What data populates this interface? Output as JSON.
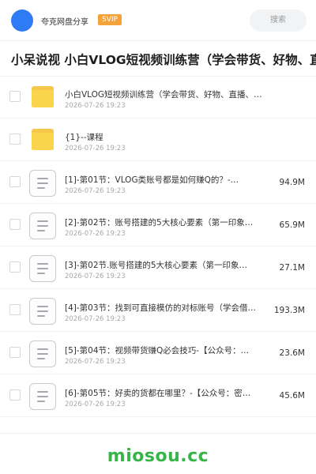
{
  "header": {
    "owner_name": "夸克网盘分享",
    "badge": "SVIP",
    "search_label": "搜索"
  },
  "page_title": "小呆说视 小白VLOG短视频训练营（学会带货、好物、直播",
  "files": [
    {
      "type": "folder",
      "name": "小白VLOG短视频训练营（学会带货、好物、直播、中…",
      "date": "2026-07-26 19:23",
      "size": ""
    },
    {
      "type": "folder",
      "name": "{1}--课程",
      "date": "2026-07-26 19:23",
      "size": ""
    },
    {
      "type": "document",
      "name": "[1]-第01节：VLOG类账号都是如何赚Q的？-…",
      "date": "2026-07-26 19:23",
      "size": "94.9M"
    },
    {
      "type": "document",
      "name": "[2]-第02节：账号搭建的5大核心要素（第一印象…",
      "date": "2026-07-26 19:23",
      "size": "65.9M"
    },
    {
      "type": "document",
      "name": "[3]-第02节.账号搭建的5大核心要素（第一印象…",
      "date": "2026-07-26 19:23",
      "size": "27.1M"
    },
    {
      "type": "document",
      "name": "[4]-第03节：找到可直接模仿的对标账号（学会借…",
      "date": "2026-07-26 19:23",
      "size": "193.3M"
    },
    {
      "type": "document",
      "name": "[5]-第04节：视频带货赚Q必会技巧-【公众号：…",
      "date": "2026-07-26 19:23",
      "size": "23.6M"
    },
    {
      "type": "document",
      "name": "[6]-第05节：好卖的货都在哪里？-【公众号：密…",
      "date": "2026-07-26 19:23",
      "size": "45.6M"
    }
  ],
  "footer": {
    "brand": "miosou.cc"
  },
  "colors": {
    "avatar": "#2f7bf6",
    "badge": "#f6a23b",
    "folder": "#fbd44e",
    "brand": "#38b549"
  }
}
